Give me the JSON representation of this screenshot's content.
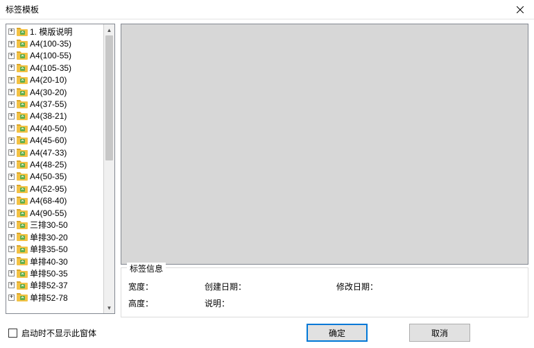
{
  "window": {
    "title": "标签模板"
  },
  "tree": {
    "items": [
      {
        "label": "1. 模版说明"
      },
      {
        "label": "A4(100-35)"
      },
      {
        "label": "A4(100-55)"
      },
      {
        "label": "A4(105-35)"
      },
      {
        "label": "A4(20-10)"
      },
      {
        "label": "A4(30-20)"
      },
      {
        "label": "A4(37-55)"
      },
      {
        "label": "A4(38-21)"
      },
      {
        "label": "A4(40-50)"
      },
      {
        "label": "A4(45-60)"
      },
      {
        "label": "A4(47-33)"
      },
      {
        "label": "A4(48-25)"
      },
      {
        "label": "A4(50-35)"
      },
      {
        "label": "A4(52-95)"
      },
      {
        "label": "A4(68-40)"
      },
      {
        "label": "A4(90-55)"
      },
      {
        "label": "三排30-50"
      },
      {
        "label": "单排30-20"
      },
      {
        "label": "单排35-50"
      },
      {
        "label": "单排40-30"
      },
      {
        "label": "单排50-35"
      },
      {
        "label": "单排52-37"
      },
      {
        "label": "单排52-78"
      }
    ]
  },
  "info": {
    "legend": "标签信息",
    "width_label": "宽度：",
    "height_label": "高度：",
    "created_label": "创建日期：",
    "desc_label": "说明：",
    "modified_label": "修改日期："
  },
  "footer": {
    "checkbox_label": "启动时不显示此窗体",
    "ok": "确定",
    "cancel": "取消"
  },
  "icons": {
    "folder_fill": "#f3c244",
    "folder_tab": "#d9a52a",
    "badge_fill": "#5fae4c"
  }
}
